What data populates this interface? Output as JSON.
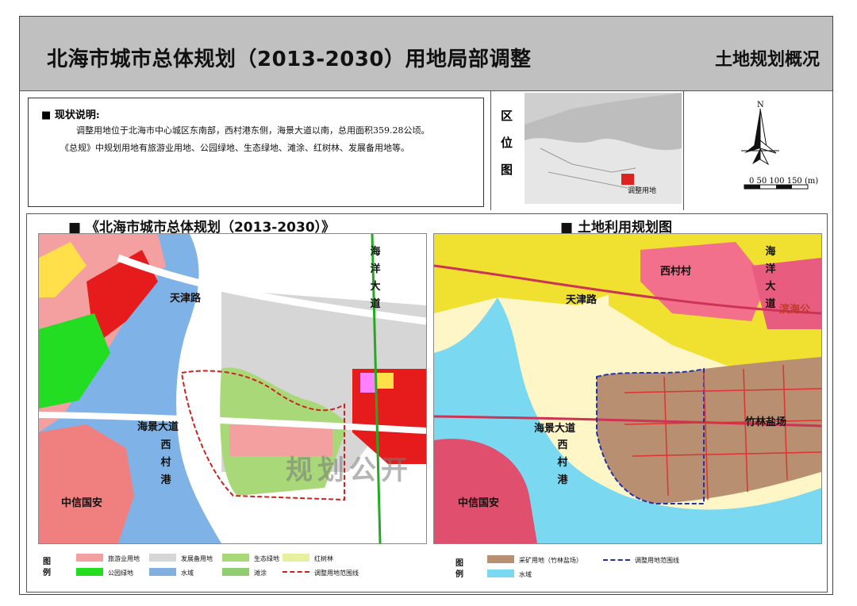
{
  "header": {
    "title": "北海市城市总体规划（2013-2030）用地局部调整",
    "right_title": "土地规划概况"
  },
  "status": {
    "heading": "现状说明:",
    "line1": "调整用地位于北海市中心城区东南部，西村港东侧，海景大道以南，总用面积359.28公顷。",
    "line2": "《总规》中规划用地有旅游业用地、公园绿地、生态绿地、滩涂、红树林、发展备用地等。"
  },
  "location": {
    "label_chars": [
      "区",
      "位",
      "图"
    ],
    "map_text": "调整用地"
  },
  "compass": {
    "north": "N",
    "scale_label": "0   50 100  150 (m)"
  },
  "left_map": {
    "title": "《北海市城市总体规划（2013-2030）》",
    "labels": {
      "tianjin_road": "天津路",
      "haijing_ave": "海景大道",
      "xicun_port": [
        "西",
        "村",
        "港"
      ],
      "zhongxin": "中信国安",
      "haiyang_ave": [
        "海",
        "洋",
        "大",
        "道"
      ]
    },
    "legend_head": [
      "图",
      "例"
    ],
    "legend": [
      {
        "label": "旅游业用地",
        "color": "#f4a0a0"
      },
      {
        "label": "发展备用地",
        "color": "#d6d6d6"
      },
      {
        "label": "生态绿地",
        "color": "#a8d878"
      },
      {
        "label": "红树林",
        "color": "#e8f0a0"
      },
      {
        "label": "公园绿地",
        "color": "#22dd22"
      },
      {
        "label": "水域",
        "color": "#80b0e0"
      },
      {
        "label": "滩涂",
        "color": "#90cc70"
      },
      {
        "label": "调整用地范围线",
        "color": "#cc2222"
      }
    ]
  },
  "right_map": {
    "title": "土地利用规划图",
    "labels": {
      "tianjin_road": "天津路",
      "haijing_ave": "海景大道",
      "xicun_port": [
        "西",
        "村",
        "港"
      ],
      "zhongxin": "中信国安",
      "xicun_village": "西村村",
      "zhulin": "竹林盐场",
      "haiyang_ave": [
        "海",
        "洋",
        "大",
        "道"
      ],
      "binhai": "滨海公"
    },
    "legend_head": [
      "图",
      "例"
    ],
    "legend": [
      {
        "label": "采矿用地（竹林盐场）",
        "color": "#b88f70"
      },
      {
        "label": "水域",
        "color": "#7ad8f0"
      },
      {
        "label": "调整用地范围线",
        "color": "#2233aa"
      }
    ]
  },
  "watermark": "规划公开"
}
